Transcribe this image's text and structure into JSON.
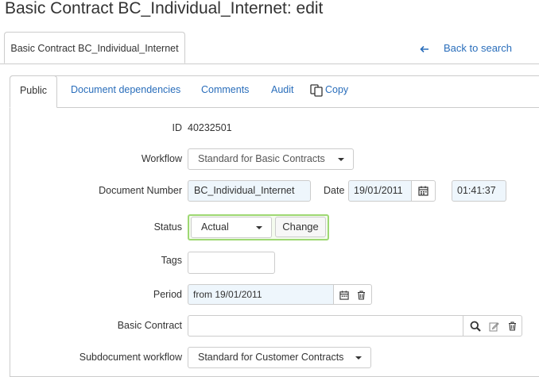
{
  "page": {
    "title": "Basic Contract BC_Individual_Internet: edit"
  },
  "outer_tab": {
    "label": "Basic Contract BC_Individual_Internet"
  },
  "back_link": {
    "label": "Back to search"
  },
  "tabs": [
    {
      "label": "Public",
      "active": true
    },
    {
      "label": "Document dependencies",
      "active": false
    },
    {
      "label": "Comments",
      "active": false
    },
    {
      "label": "Audit",
      "active": false
    },
    {
      "label": "Copy",
      "active": false,
      "icon": "copy-icon"
    }
  ],
  "form": {
    "id": {
      "label": "ID",
      "value": "40232501"
    },
    "workflow": {
      "label": "Workflow",
      "value": "Standard for Basic Contracts"
    },
    "document_number": {
      "label": "Document Number",
      "value": "BC_Individual_Internet"
    },
    "date": {
      "label": "Date",
      "value": "19/01/2011",
      "time": "01:41:37"
    },
    "status": {
      "label": "Status",
      "value": "Actual",
      "change_label": "Change",
      "highlight_color": "#9ed873"
    },
    "tags": {
      "label": "Tags",
      "value": ""
    },
    "period": {
      "label": "Period",
      "value": "from 19/01/2011"
    },
    "basic_contract": {
      "label": "Basic Contract",
      "value": ""
    },
    "subdocument_workflow": {
      "label": "Subdocument workflow",
      "value": "Standard for Customer Contracts"
    }
  },
  "colors": {
    "link": "#2a6ebb",
    "filled_field": "#eef6fc",
    "border": "#cccccc"
  }
}
